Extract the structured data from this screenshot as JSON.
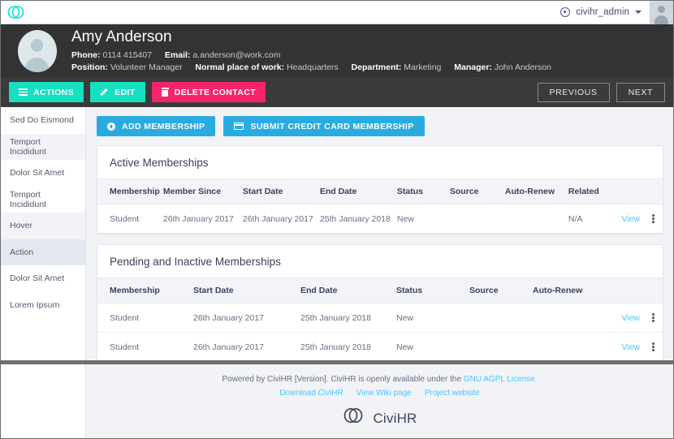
{
  "topbar": {
    "logo_icon": "civihr-logo-icon",
    "clock_icon": "clock-icon",
    "user_name": "civihr_admin",
    "caret_icon": "chevron-down-icon",
    "avatar_icon": "user-avatar-icon"
  },
  "profile": {
    "avatar_icon": "contact-avatar-icon",
    "name": "Amy Anderson",
    "phone_label": "Phone:",
    "phone_value": "0114 415407",
    "email_label": "Email:",
    "email_value": "a.anderson@work.com",
    "position_label": "Position:",
    "position_value": "Volunteer Manager",
    "workplace_label": "Normal place of work:",
    "workplace_value": "Headquarters",
    "department_label": "Department:",
    "department_value": "Marketing",
    "manager_label": "Manager:",
    "manager_value": "John Anderson"
  },
  "actionbar": {
    "actions_label": "ACTIONS",
    "edit_label": "EDIT",
    "delete_label": "DELETE CONTACT",
    "previous_label": "PREVIOUS",
    "next_label": "NEXT",
    "colors": {
      "teal": "#16e0c0",
      "pink": "#f5256b"
    }
  },
  "sidebar": {
    "items": [
      {
        "label": "Sed Do Eismond",
        "state": "default"
      },
      {
        "label": "Temport Incididunt",
        "state": "alt"
      },
      {
        "label": "Dolor Sit Amet",
        "state": "default"
      },
      {
        "label": "Temport Incididunt",
        "state": "default"
      },
      {
        "label": "Hover",
        "state": "alt"
      },
      {
        "label": "Action",
        "state": "active"
      },
      {
        "label": "Dolor Sit Amet",
        "state": "default"
      },
      {
        "label": "Lorem Ipsum",
        "state": "default"
      }
    ]
  },
  "content": {
    "add_membership_label": "ADD MEMBERSHIP",
    "submit_cc_label": "SUBMIT CREDIT CARD MEMBERSHIP",
    "button_color": "#29abe2",
    "active_table": {
      "title": "Active Memberships",
      "headers": [
        "Membership",
        "Member Since",
        "Start Date",
        "End Date",
        "Status",
        "Source",
        "Auto-Renew",
        "Related"
      ],
      "rows": [
        {
          "membership": "Student",
          "member_since": "26th January 2017",
          "start_date": "26th January 2017",
          "end_date": "25th January 2018",
          "status": "New",
          "source": "",
          "auto_renew": "",
          "related": "N/A",
          "view_label": "View"
        }
      ]
    },
    "pending_table": {
      "title": "Pending and Inactive Memberships",
      "headers": [
        "Membership",
        "Start Date",
        "End Date",
        "Status",
        "Source",
        "Auto-Renew"
      ],
      "rows": [
        {
          "membership": "Student",
          "start_date": "26th January 2017",
          "end_date": "25th January 2018",
          "status": "New",
          "source": "",
          "auto_renew": "",
          "view_label": "View"
        },
        {
          "membership": "Student",
          "start_date": "26th January 2017",
          "end_date": "25th January 2018",
          "status": "New",
          "source": "",
          "auto_renew": "",
          "view_label": "View"
        }
      ]
    }
  },
  "footer": {
    "powered_prefix": "Powered by CiviHR [Version]. CiviHR is openly available under the ",
    "license_link": "GNU AGPL License.",
    "links": [
      "Download CiviHR",
      "View Wiki page",
      "Project website"
    ],
    "logo_text": "CiviHR",
    "link_color": "#4ec3f7"
  }
}
